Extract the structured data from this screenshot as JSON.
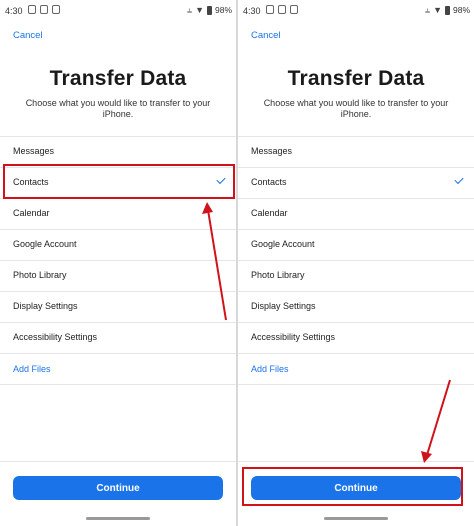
{
  "statusbar": {
    "time": "4:30",
    "battery": "98%"
  },
  "cancel_label": "Cancel",
  "title": "Transfer Data",
  "subtitle": "Choose what you would like to transfer to your iPhone.",
  "items": [
    {
      "label": "Messages",
      "checked": false
    },
    {
      "label": "Contacts",
      "checked": true
    },
    {
      "label": "Calendar",
      "checked": false
    },
    {
      "label": "Google Account",
      "checked": false
    },
    {
      "label": "Photo Library",
      "checked": false
    },
    {
      "label": "Display Settings",
      "checked": false
    },
    {
      "label": "Accessibility Settings",
      "checked": false
    }
  ],
  "add_files_label": "Add Files",
  "continue_label": "Continue",
  "colors": {
    "accent": "#1a73e8",
    "annotation": "#d0121b"
  },
  "icons": [
    "wifi-icon",
    "vibrate-icon",
    "battery-icon",
    "check-icon",
    "arrow-icon"
  ]
}
